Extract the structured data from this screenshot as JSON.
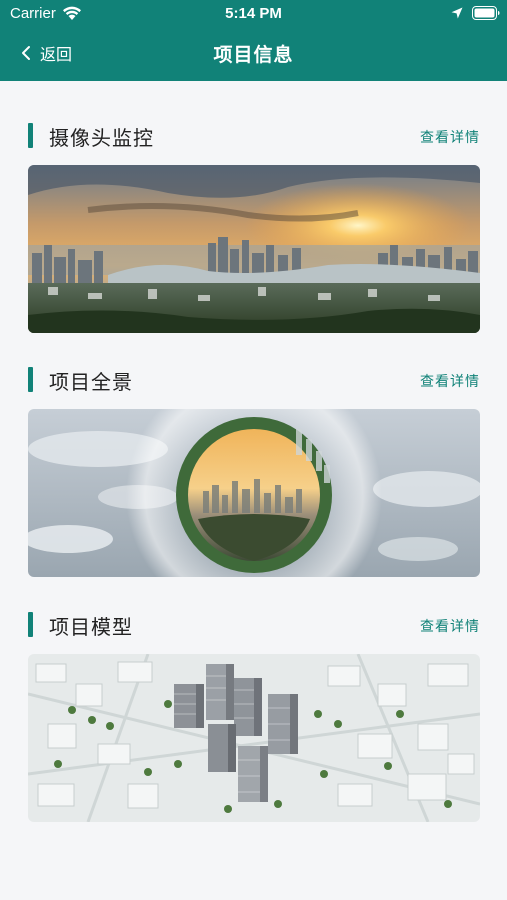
{
  "status_bar": {
    "carrier": "Carrier",
    "time": "5:14 PM"
  },
  "nav": {
    "back_label": "返回",
    "title": "项目信息"
  },
  "sections": [
    {
      "title": "摄像头监控",
      "link": "查看详情",
      "image": "city-sunset-skyline-photo"
    },
    {
      "title": "项目全景",
      "link": "查看详情",
      "image": "panorama-globe-photo"
    },
    {
      "title": "项目模型",
      "link": "查看详情",
      "image": "3d-city-model-render"
    }
  ],
  "colors": {
    "primary": "#118278",
    "background": "#f5f6f8"
  }
}
